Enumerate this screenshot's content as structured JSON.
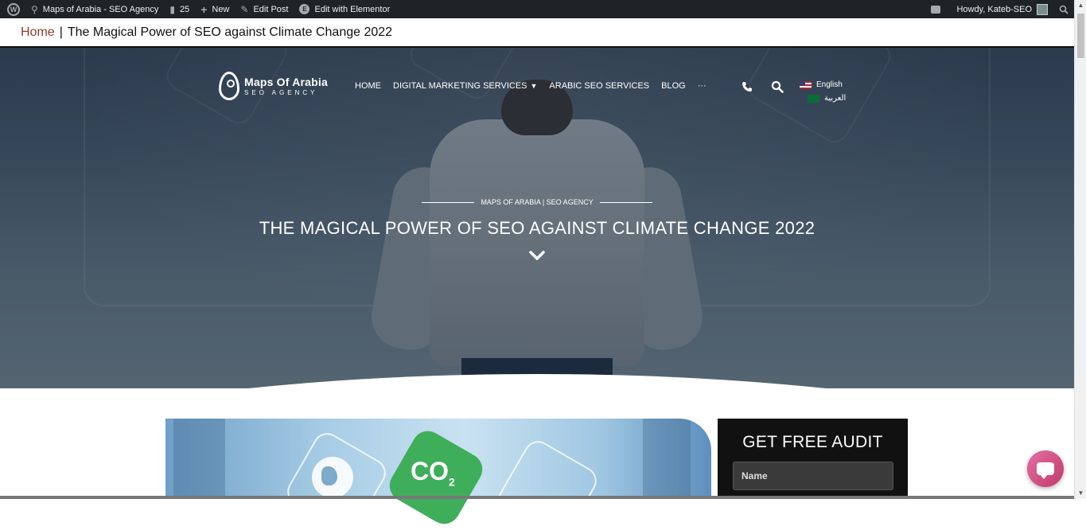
{
  "adminbar": {
    "site_name": "Maps of Arabia - SEO Agency",
    "comments_count": "25",
    "new_label": "New",
    "edit_post_label": "Edit Post",
    "elementor_label": "Edit with Elementor",
    "howdy": "Howdy, Kateb-SEO"
  },
  "breadcrumb": {
    "home": "Home",
    "separator": "|",
    "current": "The Magical Power of SEO against Climate Change 2022"
  },
  "header": {
    "logo_name": "Maps Of Arabia",
    "logo_sub": "SEO AGENCY",
    "nav": [
      {
        "label": "HOME"
      },
      {
        "label": "DIGITAL MARKETING SERVICES"
      },
      {
        "label": "ARABIC SEO SERVICES"
      },
      {
        "label": "BLOG"
      },
      {
        "label": "···"
      }
    ],
    "languages": [
      "English",
      "العربية"
    ]
  },
  "hero": {
    "eyebrow": "MAPS OF ARABIA | SEO AGENCY",
    "title": "THE MAGICAL POWER OF SEO AGAINST CLIMATE CHANGE 2022"
  },
  "feature": {
    "co2": "CO",
    "co2_sub": "2"
  },
  "audit_form": {
    "title": "GET FREE AUDIT",
    "name_placeholder": "Name"
  },
  "colors": {
    "adminbar_bg": "#1d2327",
    "breadcrumb_home": "#8e3b2b",
    "audit_bg": "#111111",
    "chat_accent": "#d4528a"
  },
  "icons": {
    "wp": "wordpress-icon",
    "comments": "comment-icon",
    "new": "plus-icon",
    "edit": "pencil-icon",
    "elementor": "elementor-icon",
    "phone": "phone-icon",
    "search": "search-icon",
    "chat": "chat-icon"
  }
}
